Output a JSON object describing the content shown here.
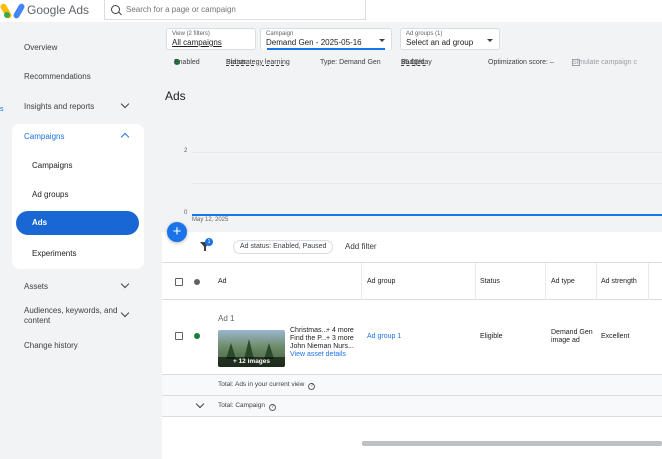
{
  "app": {
    "name": "Google Ads"
  },
  "search": {
    "placeholder": "Search for a page or campaign"
  },
  "sidebar": {
    "items": [
      {
        "label": "Overview"
      },
      {
        "label": "Recommendations"
      },
      {
        "label": "Insights and reports"
      },
      {
        "label": "Campaigns"
      },
      {
        "label": "Assets"
      },
      {
        "label": "Audiences, keywords, and content"
      },
      {
        "label": "Change history"
      }
    ],
    "campaign_sub": [
      {
        "label": "Campaigns"
      },
      {
        "label": "Ad groups"
      },
      {
        "label": "Ads"
      },
      {
        "label": "Experiments"
      }
    ],
    "edge_marks": [
      "s"
    ]
  },
  "filters": {
    "view": {
      "label": "View (2 filters)",
      "value": "All campaigns"
    },
    "campaign": {
      "label": "Campaign",
      "value": "Demand Gen - 2025-05-16"
    },
    "adgroups": {
      "label": "Ad groups (1)",
      "value": "Select an ad group"
    }
  },
  "status": {
    "enabled": "Enabled",
    "status_label": "Status:",
    "status_value": "Bid strategy learning",
    "type": "Type: Demand Gen",
    "budget_label": "Budget:",
    "budget_value": "$5.00/day",
    "optimization": "Optimization score: –",
    "simulate": "Simulate campaign c"
  },
  "page": {
    "title": "Ads"
  },
  "chart_data": {
    "type": "line",
    "y_ticks": [
      "2",
      "0"
    ],
    "x_label": "May 12, 2025",
    "series": [
      {
        "values": [
          0,
          0
        ]
      }
    ],
    "ylim": [
      0,
      2
    ]
  },
  "table": {
    "filter_badge": "1",
    "filter_chip": "Ad status: Enabled, Paused",
    "add_filter": "Add filter",
    "headers": {
      "ad": "Ad",
      "ad_group": "Ad group",
      "status": "Status",
      "ad_type": "Ad type",
      "ad_strength": "Ad strength"
    },
    "rows": [
      {
        "name": "Ad 1",
        "lines": [
          "Christmas...",
          "Find the P...",
          "John Nieman Nurs..."
        ],
        "more": [
          "+ 4 more",
          "+ 3 more"
        ],
        "view_assets": "View asset details",
        "images": "+ 12 images",
        "ad_group": "Ad group 1",
        "status": "Eligible",
        "ad_type_1": "Demand Gen",
        "ad_type_2": "image ad",
        "ad_strength": "Excellent"
      }
    ],
    "total_view": "Total: Ads in your current view",
    "total_campaign": "Total: Campaign",
    "help_glyph": "?"
  },
  "colors": {
    "accent": "#1a73e8",
    "enabled": "#188038",
    "nav_active": "#1967d2"
  },
  "icons": [
    "search-icon",
    "chevron-down-icon",
    "chevron-up-icon",
    "filter-icon",
    "add-icon",
    "help-icon"
  ]
}
